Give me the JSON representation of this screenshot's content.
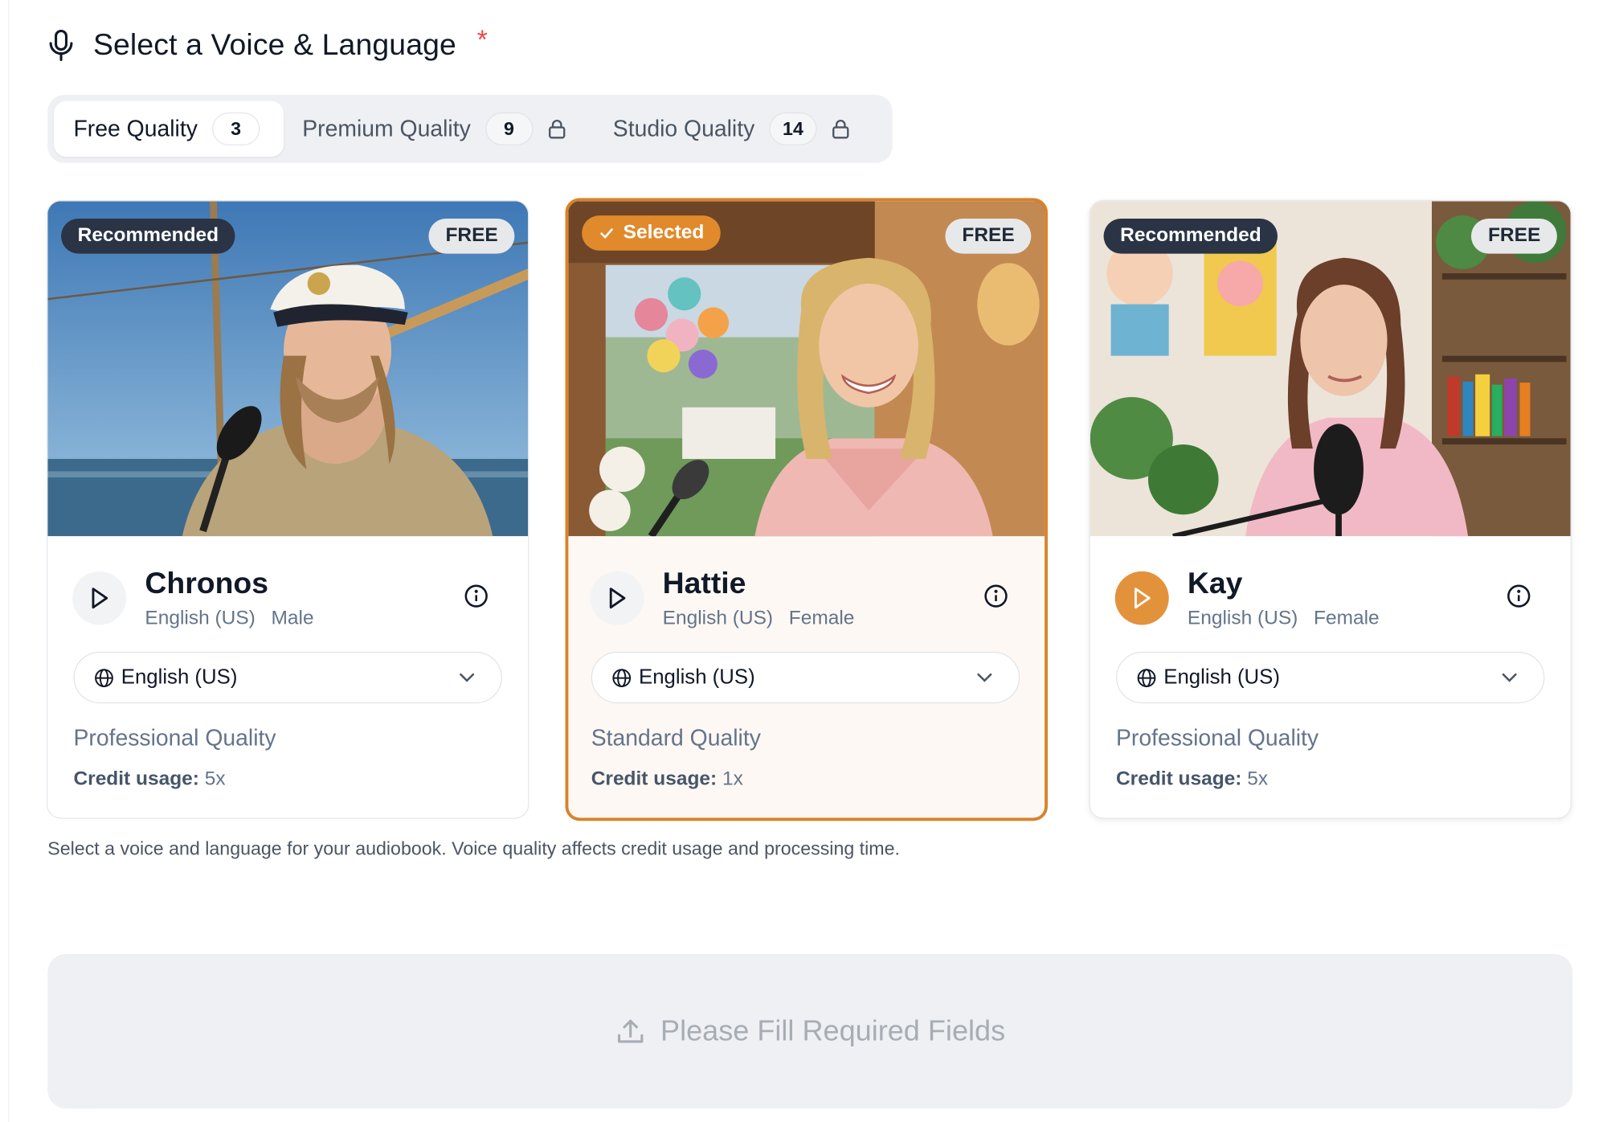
{
  "header": {
    "title": "Select a Voice & Language",
    "required_mark": "*"
  },
  "tabs": [
    {
      "label": "Free Quality",
      "count": "3",
      "active": true,
      "locked": false
    },
    {
      "label": "Premium Quality",
      "count": "9",
      "active": false,
      "locked": true
    },
    {
      "label": "Studio Quality",
      "count": "14",
      "active": false,
      "locked": true
    }
  ],
  "voices": [
    {
      "badge": "Recommended",
      "price": "FREE",
      "name": "Chronos",
      "language": "English (US)",
      "gender": "Male",
      "select_value": "English (US)",
      "quality": "Professional Quality",
      "credit_label": "Credit usage:",
      "credit_value": "5x",
      "selected": false,
      "playing": false
    },
    {
      "badge": "Selected",
      "price": "FREE",
      "name": "Hattie",
      "language": "English (US)",
      "gender": "Female",
      "select_value": "English (US)",
      "quality": "Standard Quality",
      "credit_label": "Credit usage:",
      "credit_value": "1x",
      "selected": true,
      "playing": false
    },
    {
      "badge": "Recommended",
      "price": "FREE",
      "name": "Kay",
      "language": "English (US)",
      "gender": "Female",
      "select_value": "English (US)",
      "quality": "Professional Quality",
      "credit_label": "Credit usage:",
      "credit_value": "5x",
      "selected": false,
      "playing": true
    }
  ],
  "hint": "Select a voice and language for your audiobook. Voice quality affects credit usage and processing time.",
  "submit": {
    "label": "Please Fill Required Fields"
  },
  "colors": {
    "accent": "#d9822b",
    "badge_dark": "#2b3445",
    "required": "#ef4444",
    "muted_text": "#64748b"
  }
}
